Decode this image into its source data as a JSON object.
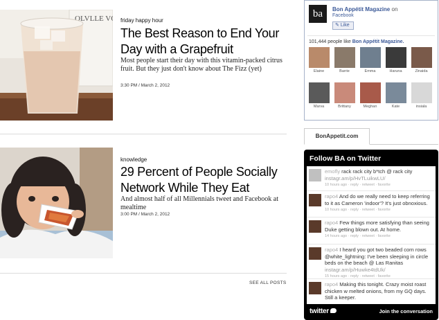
{
  "posts": [
    {
      "kicker": "friday happy hour",
      "headline": "The Best Reason to End Your Day with a Grapefruit",
      "dek": "Most people start their day with this vitamin-packed citrus fruit. But they just don't know about The Fizz (yet)",
      "meta": "3:30 PM / March 2, 2012",
      "image_bottle_label": "OLVLLE VODK"
    },
    {
      "kicker": "knowledge",
      "headline": "29 Percent of People Socially Network While They Eat",
      "dek": "And almost half of all Millennials tweet and Facebook at mealtime",
      "meta": "3:00 PM / March 2, 2012"
    }
  ],
  "see_all": "SEE ALL POSTS",
  "facebook": {
    "logo": "ba",
    "page_name": "Bon Appétit Magazine",
    "on_text": "on",
    "sub": "Facebook",
    "like_label": "Like",
    "count": "101,444",
    "count_suffix": "people like",
    "count_page": "Bon Appétit Magazine.",
    "faces": [
      {
        "name": "Elaine",
        "color": "#b98a6a"
      },
      {
        "name": "Barrie",
        "color": "#8a7a6a"
      },
      {
        "name": "Emma",
        "color": "#6f7f8f"
      },
      {
        "name": "Haruna",
        "color": "#3a3a3a"
      },
      {
        "name": "Zinaida",
        "color": "#7a5a4a"
      },
      {
        "name": "Marva",
        "color": "#5a5a5a"
      },
      {
        "name": "Brittany",
        "color": "#c98a7a"
      },
      {
        "name": "Meghan",
        "color": "#a85a4a"
      },
      {
        "name": "Kate",
        "color": "#7a8a9a"
      },
      {
        "name": "insiala",
        "color": "#d8d8d8"
      }
    ]
  },
  "tab_label": "BonAppetit.com",
  "twitter": {
    "title": "Follow BA on Twitter",
    "tweets": [
      {
        "user": "emofly",
        "text": " rack rack city b*tch @ rack city ",
        "link": "instagr.am/p/HvTLuikwLU/",
        "foot": "10 hours ago · reply · retweet · favorite",
        "avatar": "#c0c0c0"
      },
      {
        "user": "rapo4",
        "text": " And do we really need to keep referring to it as Cameron 'indoor'? It's just obnoxious.",
        "link": "",
        "foot": "10 hours ago · reply · retweet · favorite",
        "avatar": "#5a3a2a"
      },
      {
        "user": "rapo4",
        "text": " Few things more satisfying than seeing Duke getting blown out. At home.",
        "link": "",
        "foot": "14 hours ago · reply · retweet · favorite",
        "avatar": "#5a3a2a"
      },
      {
        "user": "rapo4",
        "text": " I heard you got two beaded corn rows @white_lightning: I've been sleeping in circle beds on the beach @ Las Ranitas ",
        "link": "instagr.am/p/Huwke4tdUk/",
        "foot": "15 hours ago · reply · retweet · favorite",
        "avatar": "#5a3a2a"
      },
      {
        "user": "rapo4",
        "text": " Making this tonight. Crazy moist roast chicken w melted onions, from my GQ days. Still a keeper.",
        "link": "",
        "foot": "",
        "avatar": "#5a3a2a"
      }
    ],
    "logo_text": "twitter",
    "join_label": "Join the conversation"
  }
}
